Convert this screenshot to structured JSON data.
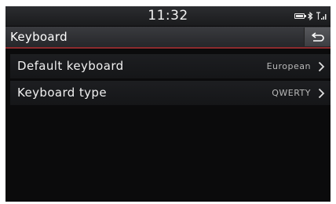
{
  "status": {
    "time": "11:32",
    "icons": [
      "battery-icon",
      "bluetooth-icon",
      "signal-icon"
    ]
  },
  "header": {
    "title": "Keyboard",
    "back_icon": "back-arrow-icon"
  },
  "settings": [
    {
      "label": "Default keyboard",
      "value": "European"
    },
    {
      "label": "Keyboard type",
      "value": "QWERTY"
    }
  ],
  "colors": {
    "accent_line": "#8c2b2e",
    "background": "#0b0b0c"
  }
}
